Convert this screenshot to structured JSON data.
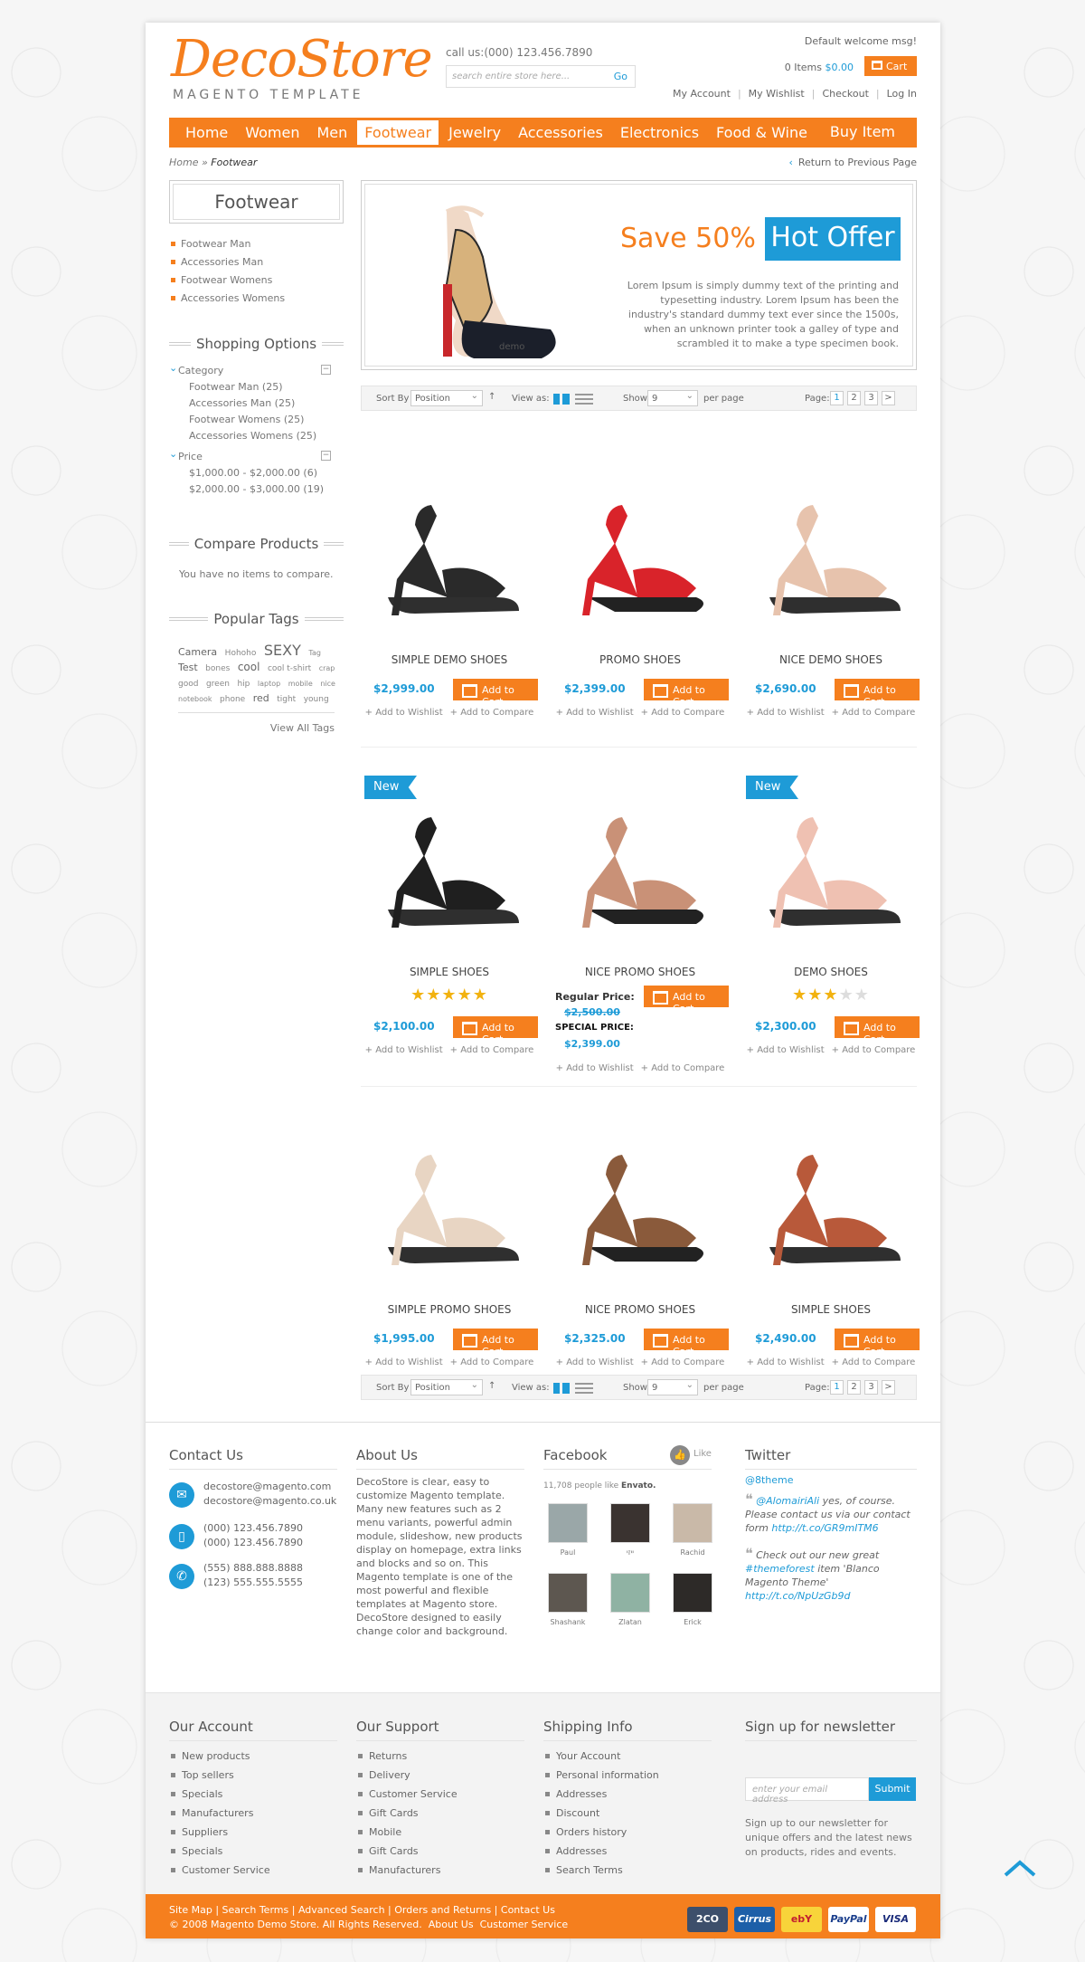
{
  "header": {
    "logo": "DecoStore",
    "logo_sub": "MAGENTO TEMPLATE",
    "call_us": "call us:(000) 123.456.7890",
    "search_placeholder": "search entire store here...",
    "search_go": "Go",
    "welcome": "Default welcome msg!",
    "items_label": "0 Items",
    "items_total": "$0.00",
    "cart": "Cart",
    "links": [
      "My Account",
      "My Wishlist",
      "Checkout",
      "Log In"
    ]
  },
  "nav": {
    "items": [
      "Home",
      "Women",
      "Men",
      "Footwear",
      "Jewelry",
      "Accessories",
      "Electronics",
      "Food & Wine"
    ],
    "active": "Footwear",
    "buy": "Buy Item"
  },
  "breadcrumb": {
    "home": "Home",
    "sep": "»",
    "current": "Footwear"
  },
  "back": "Return to Previous Page",
  "sidebar": {
    "title": "Footwear",
    "categories": [
      "Footwear Man",
      "Accessories Man",
      "Footwear Womens",
      "Accessories Womens"
    ],
    "shopping_title": "Shopping Options",
    "category_label": "Category",
    "category_options": [
      "Footwear Man (25)",
      "Accessories Man (25)",
      "Footwear Womens (25)",
      "Accessories Womens (25)"
    ],
    "price_label": "Price",
    "price_options": [
      "$1,000.00 - $2,000.00 (6)",
      "$2,000.00 - $3,000.00 (19)"
    ],
    "compare_title": "Compare Products",
    "compare_text": "You have no items to compare.",
    "tags_title": "Popular Tags",
    "tags": [
      [
        "Camera",
        11
      ],
      [
        "Hohoho",
        9
      ],
      [
        "SEXY",
        16
      ],
      [
        "Tag",
        8
      ],
      [
        "Test",
        11
      ],
      [
        "bones",
        9
      ],
      [
        "cool",
        12
      ],
      [
        "cool t-shirt",
        9
      ],
      [
        "crap",
        8
      ],
      [
        "good",
        9
      ],
      [
        "green",
        9
      ],
      [
        "hip",
        9
      ],
      [
        "laptop",
        8
      ],
      [
        "mobile",
        8
      ],
      [
        "nice",
        8
      ],
      [
        "notebook",
        8
      ],
      [
        "phone",
        9
      ],
      [
        "red",
        11
      ],
      [
        "tight",
        9
      ],
      [
        "young",
        9
      ]
    ],
    "view_all": "View All Tags"
  },
  "banner": {
    "save": "Save 50%",
    "hot": "Hot Offer",
    "text": "Lorem Ipsum is simply dummy text of the printing and typesetting industry. Lorem Ipsum has been the industry's standard dummy text ever since the 1500s, when an unknown printer took a galley of type and scrambled it to make a type specimen book.",
    "demo": "demo"
  },
  "toolbar": {
    "sort_by": "Sort By",
    "sort_value": "Position",
    "view_as": "View as:",
    "show": "Show",
    "show_value": "9",
    "per_page": "per page",
    "page": "Page:",
    "pages": [
      "1",
      "2",
      "3",
      ">"
    ]
  },
  "add_to_cart": "Add to Cart",
  "add_wishlist": "+ Add to Wishlist",
  "add_compare": "+ Add to Compare",
  "products": [
    {
      "name": "SIMPLE DEMO SHOES",
      "price": "$2,999.00",
      "color": "#2a2a2a"
    },
    {
      "name": "PROMO SHOES",
      "price": "$2,399.00",
      "color": "#d9232a"
    },
    {
      "name": "NICE DEMO SHOES",
      "price": "$2,690.00",
      "color": "#e7c3ad"
    },
    {
      "name": "SIMPLE SHOES",
      "price": "$2,100.00",
      "badge": "New",
      "rating": 4.5,
      "color": "#1f1f1f"
    },
    {
      "name": "NICE PROMO SHOES",
      "regular_label": "Regular Price:",
      "regular": "$2,500.00",
      "special_label": "SPECIAL PRICE:",
      "special": "$2,399.00",
      "color": "#c99177"
    },
    {
      "name": "DEMO SHOES",
      "price": "$2,300.00",
      "badge": "New",
      "rating": 2.5,
      "color": "#efc1b2"
    },
    {
      "name": "SIMPLE PROMO SHOES",
      "price": "$1,995.00",
      "color": "#e8d5c3"
    },
    {
      "name": "NICE PROMO SHOES",
      "price": "$2,325.00",
      "color": "#8a5a3b"
    },
    {
      "name": "SIMPLE SHOES",
      "price": "$2,490.00",
      "color": "#b8593a"
    }
  ],
  "footer": {
    "contact_title": "Contact Us",
    "emails": [
      "decostore@magento.com",
      "decostore@magento.co.uk"
    ],
    "phones": [
      "(000) 123.456.7890",
      "(000) 123.456.7890"
    ],
    "mobiles": [
      "(555) 888.888.8888",
      "(123) 555.555.5555"
    ],
    "about_title": "About Us",
    "about_text": "DecoStore is clear, easy to customize Magento template. Many new features such as 2 menu variants, powerful admin module, slideshow, new products display on homepage, extra links and blocks and so on. This Magento template is one of the most powerful and flexible templates at Magento store. DecoStore designed to easily change color and background.",
    "facebook_title": "Facebook",
    "like": "Like",
    "fb_count": "11,708 people like",
    "fb_page": "Envato.",
    "fb_people": [
      "Paul",
      "ייזי",
      "Rachid",
      "Shashank",
      "Zlatan",
      "Erick"
    ],
    "twitter_title": "Twitter",
    "twitter_handle": "@8theme",
    "tweets": [
      {
        "user": "@AlomairiAli",
        "text": " yes, of course. Please contact us via our contact form ",
        "link": "http://t.co/GR9mITM6"
      },
      {
        "user": "",
        "text": "Check out our new great ",
        "tag": "#themeforest",
        "text2": " item 'Blanco Magento Theme' ",
        "link": "http://t.co/NpUzGb9d"
      }
    ],
    "account_title": "Our Account",
    "account_items": [
      "New products",
      "Top sellers",
      "Specials",
      "Manufacturers",
      "Suppliers",
      "Specials",
      "Customer Service"
    ],
    "support_title": "Our Support",
    "support_items": [
      "Returns",
      "Delivery",
      "Customer Service",
      "Gift Cards",
      "Mobile",
      "Gift Cards",
      "Manufacturers"
    ],
    "shipping_title": "Shipping Info",
    "shipping_items": [
      "Your Account",
      "Personal information",
      "Addresses",
      "Discount",
      "Orders history",
      "Addresses",
      "Search Terms"
    ],
    "newsletter_title": "Sign up for newsletter",
    "newsletter_placeholder": "enter your email address",
    "subscribe": "Submit",
    "newsletter_note": "Sign up to our newsletter for unique offers and the latest news on products, rides and events.",
    "bottom_links": [
      "Site Map",
      "Search Terms",
      "Advanced Search",
      "Orders and Returns",
      "Contact Us"
    ],
    "copyright": "© 2008 Magento Demo Store. All Rights Reserved.",
    "bottom_links2": [
      "About Us",
      "Customer Service"
    ],
    "cards": [
      "2CO",
      "Cirrus",
      "ebY",
      "PayPal",
      "VISA"
    ]
  },
  "colors": {
    "accent": "#f57f1e",
    "blue": "#1e9bd7"
  }
}
